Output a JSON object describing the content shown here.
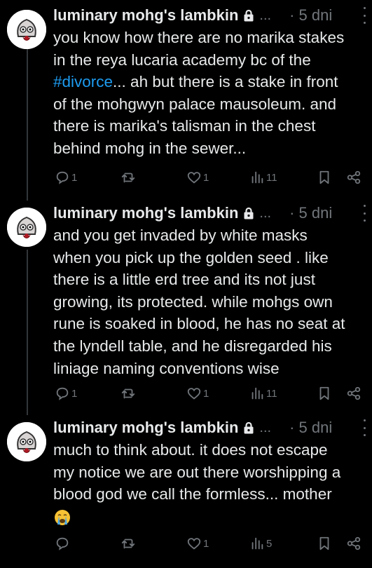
{
  "tweets": [
    {
      "name": "luminary mohg's lambkin",
      "ellipsis": "...",
      "time": "· 5 dni",
      "lines": [
        "you know how there are no marika stakes",
        "in the reya lucaria academy bc of the",
        "... ah but there is a stake in front",
        "of the mohgwyn palace mausoleum. and",
        "there is marika's talisman in the chest",
        "behind mohg in the sewer..."
      ],
      "hashtag": "#divorce",
      "replies": "1",
      "retweets": "",
      "likes": "1",
      "views": "11"
    },
    {
      "name": "luminary mohg's lambkin",
      "ellipsis": "...",
      "time": "· 5 dni",
      "lines": [
        "and you get invaded by white masks",
        "when you pick up the golden seed . like",
        "there is a little erd tree and its not just",
        "growing, its protected. while mohgs own",
        "rune is soaked in blood, he has no seat at",
        "the lyndell table, and he disregarded his",
        "liniage naming conventions wise"
      ],
      "replies": "1",
      "retweets": "",
      "likes": "1",
      "views": "11"
    },
    {
      "name": "luminary mohg's lambkin",
      "ellipsis": "...",
      "time": "· 5 dni",
      "lines": [
        "much to think about. it does not escape",
        "my notice we are out there worshipping a",
        "blood god we call the formless... mother"
      ],
      "emoji": "crying-face-emoji",
      "replies": "",
      "retweets": "",
      "likes": "1",
      "views": "5"
    }
  ],
  "colors": {
    "background": "#000000",
    "text": "#e7e9ea",
    "muted": "#71767b",
    "link": "#1d9bf0",
    "thread_line": "#333639"
  }
}
